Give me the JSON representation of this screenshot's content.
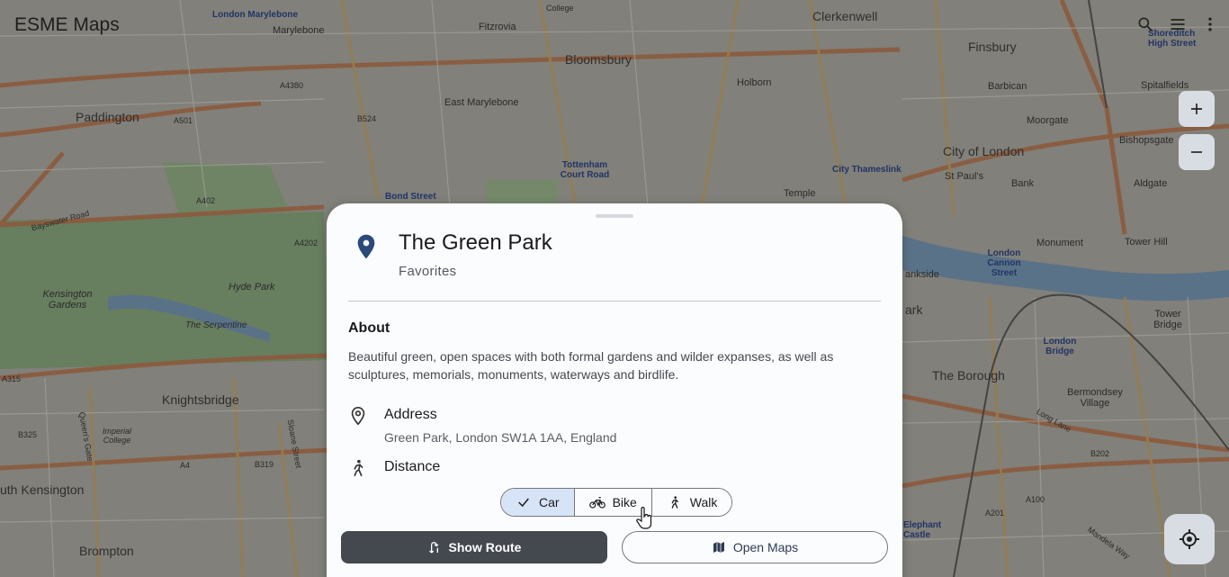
{
  "app": {
    "title": "ESME Maps"
  },
  "map": {
    "labels": {
      "marylebone": "Marylebone",
      "london_marylebone": "London Marylebone",
      "fitzrovia": "Fitzrovia",
      "college": "College",
      "bloomsbury": "Bloomsbury",
      "clerkenwell": "Clerkenwell",
      "finsbury": "Finsbury",
      "shoreditch": "Shoreditch High Street",
      "barbican": "Barbican",
      "spitalfields": "Spitalfields",
      "holborn": "Holborn",
      "a4380": "A4380",
      "a501": "A501",
      "b524": "B524",
      "east_marylebone": "East Marylebone",
      "moorgate": "Moorgate",
      "bishopsgate": "Bishopsgate",
      "paddington": "Paddington",
      "tottenham": "Tottenham Court Road",
      "city_of_london": "City of London",
      "st_pauls": "St Paul's",
      "bank": "Bank",
      "aldgate": "Aldgate",
      "city_thameslink": "City Thameslink",
      "temple": "Temple",
      "bond_street": "Bond Street",
      "a402": "A402",
      "bayswater": "Bayswater Road",
      "a4202": "A4202",
      "hyde_park": "Hyde Park",
      "kensington_gardens": "Kensington Gardens",
      "serpentine": "The Serpentine",
      "knightsbridge": "Knightsbridge",
      "imperial": "Imperial College",
      "b325": "B325",
      "queens_gate": "Queen's Gate",
      "a4": "A4",
      "b319": "B319",
      "sloane_street": "Sloane Street",
      "south_kensington": "uth Kensington",
      "brompton": "Brompton",
      "a315": "A315",
      "london_cannon": "London Cannon Street",
      "monument": "Monument",
      "tower_hill": "Tower Hill",
      "tower_bridge": "Tower Bridge",
      "bankside": "ankside",
      "ark": "ark",
      "london_bridge": "London Bridge",
      "the_borough": "The Borough",
      "bermondsey": "Bermondsey Village",
      "long_lane": "Long Lane",
      "b202": "B202",
      "a100": "A100",
      "a201": "A201",
      "elephant": "Elephant Castle",
      "mandela": "Mandela Way"
    }
  },
  "toolbar": {
    "icons": [
      "search-icon",
      "menu-icon",
      "more-vert-icon"
    ]
  },
  "controls": {
    "zoom_in": "+",
    "zoom_out": "−"
  },
  "sheet": {
    "title": "The Green Park",
    "subtitle": "Favorites",
    "about_heading": "About",
    "about_text": "Beautiful green, open spaces with both formal gardens and wilder expanses, as well as sculptures, memorials, monuments, waterways and birdlife.",
    "address_label": "Address",
    "address_value": "Green Park, London SW1A 1AA, England",
    "distance_label": "Distance",
    "modes": [
      {
        "label": "Car",
        "selected": true
      },
      {
        "label": "Bike",
        "selected": false
      },
      {
        "label": "Walk",
        "selected": false
      }
    ],
    "show_route": "Show Route",
    "open_maps": "Open Maps"
  },
  "colors": {
    "accent": "#2b4a78",
    "segment_selected": "#d7e3f7",
    "primary_button": "#44484f"
  }
}
